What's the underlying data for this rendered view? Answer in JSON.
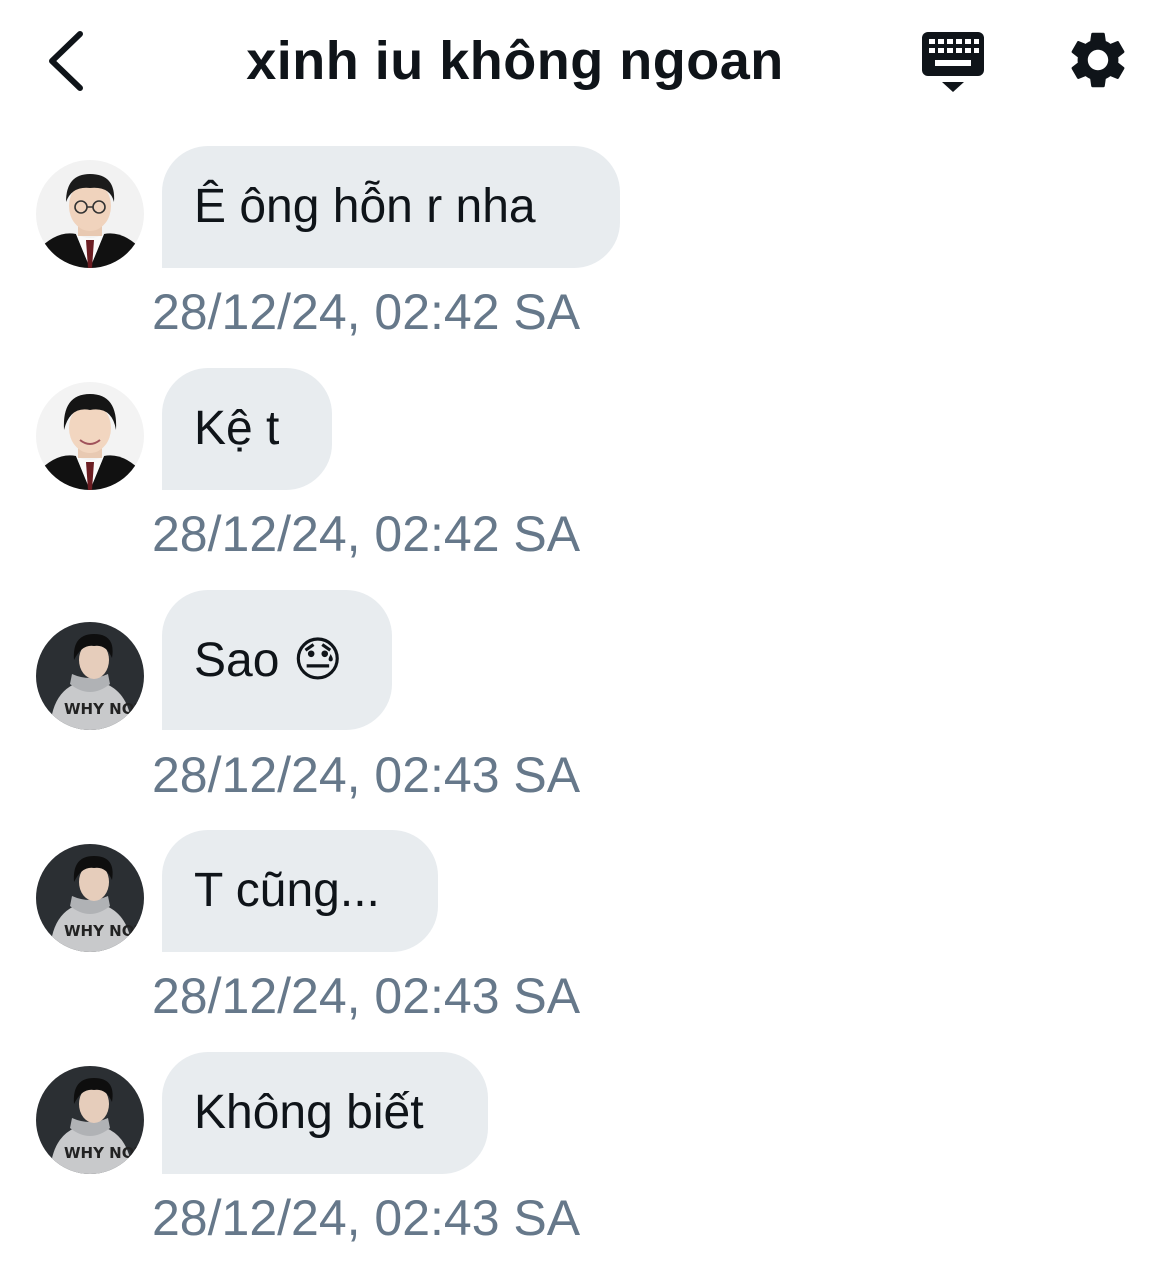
{
  "header": {
    "title": "xinh iu không ngoan",
    "back_icon": "chevron-left-icon",
    "keyboard_icon": "keyboard-icon",
    "settings_icon": "gear-icon"
  },
  "messages": [
    {
      "text": "Ê ông hỗn r nha",
      "time": "28/12/24, 02:42 SA",
      "avatar": "avatar-boy-glasses"
    },
    {
      "text": "Kệ t",
      "time": "28/12/24, 02:42 SA",
      "avatar": "avatar-boy-smiling"
    },
    {
      "text": "Sao",
      "emoji": "😓",
      "time": "28/12/24, 02:43 SA",
      "avatar": "avatar-boy-hoodie"
    },
    {
      "text": "T cũng...",
      "time": "28/12/24, 02:43 SA",
      "avatar": "avatar-boy-hoodie"
    },
    {
      "text": "Không biết",
      "time": "28/12/24, 02:43 SA",
      "avatar": "avatar-boy-hoodie"
    }
  ]
}
